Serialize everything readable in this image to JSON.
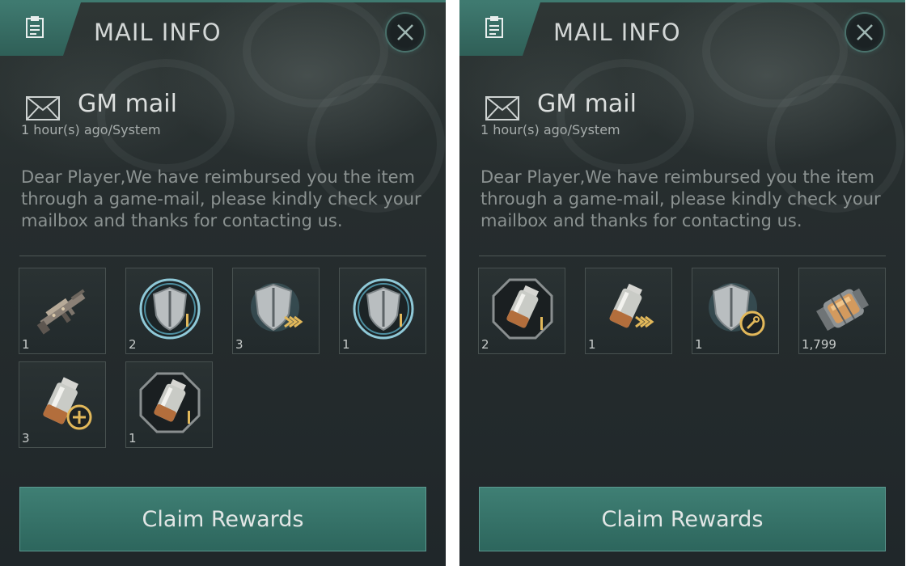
{
  "panels": [
    {
      "header": {
        "title": "MAIL INFO"
      },
      "mail": {
        "title": "GM mail",
        "meta": "1 hour(s) ago/System",
        "body": "Dear Player,We have reimbursed you the item through a game-mail, please kindly check your mailbox and thanks for contacting us."
      },
      "items": [
        {
          "icon": "rifle-icon",
          "qty": "1"
        },
        {
          "icon": "shield-circle-icon",
          "qty": "2"
        },
        {
          "icon": "shield-upgrade-icon",
          "qty": "3"
        },
        {
          "icon": "shield-circle-icon",
          "qty": "1"
        },
        {
          "icon": "battery-plus-icon",
          "qty": "3"
        },
        {
          "icon": "battery-octagon-icon",
          "qty": "1"
        }
      ],
      "claim_label": "Claim Rewards"
    },
    {
      "header": {
        "title": "MAIL INFO"
      },
      "mail": {
        "title": "GM mail",
        "meta": "1 hour(s) ago/System",
        "body": "Dear Player,We have reimbursed you the item through a game-mail, please kindly check your mailbox and thanks for contacting us."
      },
      "items": [
        {
          "icon": "battery-octagon-icon",
          "qty": "2"
        },
        {
          "icon": "battery-upgrade-icon",
          "qty": "1"
        },
        {
          "icon": "shield-wrench-icon",
          "qty": "1"
        },
        {
          "icon": "energy-canister-icon",
          "qty": "1,799"
        }
      ],
      "claim_label": "Claim Rewards"
    }
  ],
  "colors": {
    "accent": "#3f7a70",
    "gold": "#e2b85a",
    "panel_bg": "#262d2e"
  }
}
